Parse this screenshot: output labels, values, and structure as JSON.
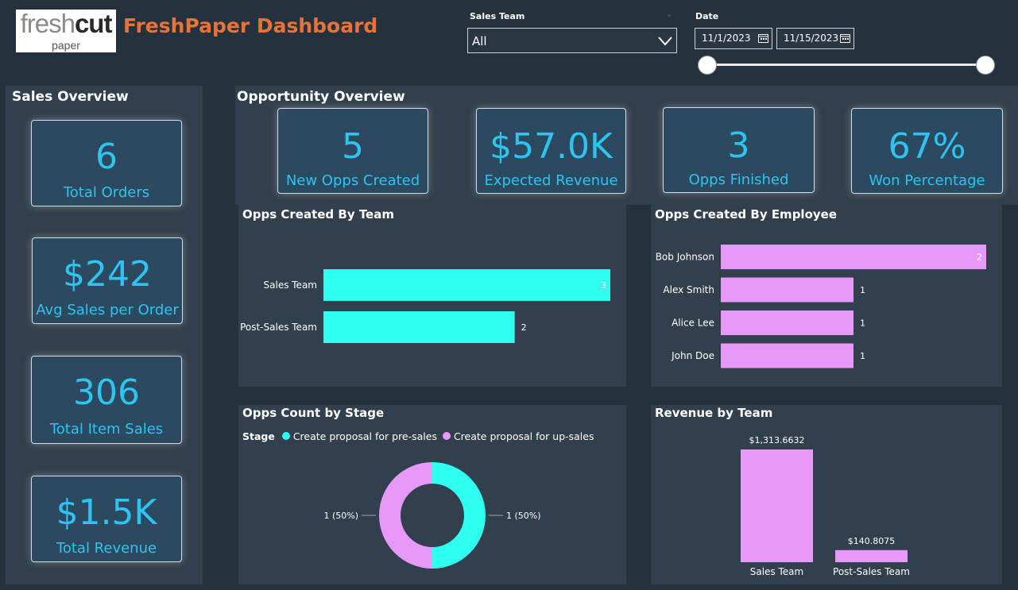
{
  "header": {
    "logo_word1": "fresh",
    "logo_word2": "cut",
    "logo_sub": "paper",
    "title": "FreshPaper Dashboard",
    "title_color": "#e8733a"
  },
  "filters": {
    "sales_team_label": "Sales Team",
    "sales_team_value": "All",
    "date_label": "Date",
    "date_start": "11/1/2023",
    "date_end": "11/15/2023"
  },
  "sales_overview": {
    "title": "Sales Overview",
    "kpis": [
      {
        "value": "6",
        "label": "Total Orders"
      },
      {
        "value": "$242",
        "label": "Avg Sales per Order"
      },
      {
        "value": "306",
        "label": "Total Item Sales"
      },
      {
        "value": "$1.5K",
        "label": "Total Revenue"
      }
    ]
  },
  "opportunity_overview": {
    "title": "Opportunity Overview",
    "kpis": [
      {
        "value": "5",
        "label": "New Opps Created"
      },
      {
        "value": "$57.0K",
        "label": "Expected Revenue"
      },
      {
        "value": "3",
        "label": "Opps Finished"
      },
      {
        "value": "67%",
        "label": "Won Percentage"
      }
    ]
  },
  "colors": {
    "accent_text": "#2ec3f0",
    "cyan_bar": "#2ffff0",
    "pink_bar": "#e799f9"
  },
  "chart_data": [
    {
      "id": "opps_by_team",
      "type": "bar",
      "orientation": "horizontal",
      "title": "Opps Created By Team",
      "categories": [
        "Sales Team",
        "Post-Sales Team"
      ],
      "values": [
        3,
        2
      ],
      "data_labels": [
        "3",
        "2"
      ],
      "color": "#2ffff0",
      "xlim": [
        0,
        3
      ]
    },
    {
      "id": "opps_by_employee",
      "type": "bar",
      "orientation": "horizontal",
      "title": "Opps Created By Employee",
      "categories": [
        "Bob Johnson",
        "Alex Smith",
        "Alice Lee",
        "John Doe"
      ],
      "values": [
        2,
        1,
        1,
        1
      ],
      "data_labels": [
        "2",
        "1",
        "1",
        "1"
      ],
      "color": "#e799f9",
      "xlim": [
        0,
        2
      ]
    },
    {
      "id": "opps_by_stage",
      "type": "pie",
      "donut": true,
      "title": "Opps Count by Stage",
      "legend_title": "Stage",
      "legend_placement": "top-left",
      "categories": [
        "Create proposal for pre-sales",
        "Create proposal for up-sales"
      ],
      "values": [
        1,
        1
      ],
      "data_labels": [
        "1 (50%)",
        "1 (50%)"
      ],
      "colors": [
        "#2ffff0",
        "#e799f9"
      ]
    },
    {
      "id": "revenue_by_team",
      "type": "bar",
      "orientation": "vertical",
      "title": "Revenue by Team",
      "categories": [
        "Sales Team",
        "Post-Sales Team"
      ],
      "values": [
        1313.6632,
        140.8075
      ],
      "data_labels": [
        "$1,313.6632",
        "$140.8075"
      ],
      "color": "#e799f9",
      "ylim": [
        0,
        1313.6632
      ]
    }
  ]
}
